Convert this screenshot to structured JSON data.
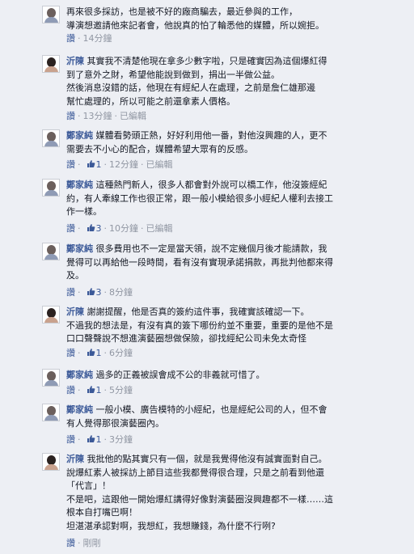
{
  "like_label": "讚",
  "dot": "·",
  "comments": [
    {
      "author": "",
      "lines": [
        "再來很多採訪，也是被不好的廠商騙去，最近參與的工作，",
        "導演想邀請他來記者會，他說真的怕了輪悉他的媒體，所以婉拒。"
      ],
      "likes": "",
      "time": "14分鐘",
      "edited": ""
    },
    {
      "author": "沂陳",
      "lines": [
        "其實我不清楚他現在拿多少數字啦，只是確實因為這個爆紅得",
        "到了意外之財，希望他能說到做到，捐出一半做公益。",
        "然後消息沒錯的話，他現在有經紀人在處理，之前是詹仁雄那邊",
        "幫忙處理的，所以可能之前還拿素人價格。"
      ],
      "likes": "",
      "time": "13分鐘",
      "edited": "已編輯"
    },
    {
      "author": "鄭家純",
      "lines": [
        "媒體看勢頭正熱，好好利用他一番，對他沒興趣的人，更不",
        "需要去不小心的配合，媒體希望大眾有的反感。"
      ],
      "likes": "1",
      "time": "12分鐘",
      "edited": "已編輯"
    },
    {
      "author": "鄭家純",
      "lines": [
        "這種熱門新人，很多人都會對外說可以橋工作，他沒簽經紀",
        "約，有人牽線工作也很正常，跟一般小模給很多小經紀人權利去接工",
        "作一樣。"
      ],
      "likes": "3",
      "time": "10分鐘",
      "edited": "已編輯"
    },
    {
      "author": "鄭家純",
      "lines": [
        "很多費用也不一定是當天領，說不定幾個月後才能請款，我",
        "覺得可以再給他一段時間，看有沒有實現承諾捐款，再批判他都來得",
        "及。"
      ],
      "likes": "3",
      "time": "8分鐘",
      "edited": ""
    },
    {
      "author": "沂陳",
      "lines": [
        "謝謝提醒，他是否真的簽約這件事，我確實該確認一下。",
        "不過我的想法是，有沒有真的簽下哪份約並不重要，重要的是他不是",
        "口口聲聲說不想進演藝圈想做保險，卻找經紀公司未免太奇怪"
      ],
      "likes": "1",
      "time": "6分鐘",
      "edited": ""
    },
    {
      "author": "鄭家純",
      "lines": [
        "過多的正義被誤會成不公的非義就可惜了。"
      ],
      "likes": "1",
      "time": "5分鐘",
      "edited": ""
    },
    {
      "author": "鄭家純",
      "lines": [
        "一般小模、廣告模特的小經紀，也是經紀公司的人，但不會",
        "有人覺得那很演藝圈內。"
      ],
      "likes": "1",
      "time": "3分鐘",
      "edited": ""
    },
    {
      "author": "沂陳",
      "lines": [
        "我批他的點其實只有一個，就是我覺得他沒有誠實面對自己。",
        "說爆紅素人被採訪上節目這些我都覺得很合理，只是之前看到他還",
        "「代言」！",
        "不是吧，這跟他一開始爆紅講得好像對演藝圈沒興趣都不一樣……這",
        "根本自打嘴巴啊！",
        "坦湛湛承認對啊，我想紅，我想賺錢，為什麼不行咧?"
      ],
      "likes": "",
      "time": "剛剛",
      "edited": ""
    }
  ]
}
